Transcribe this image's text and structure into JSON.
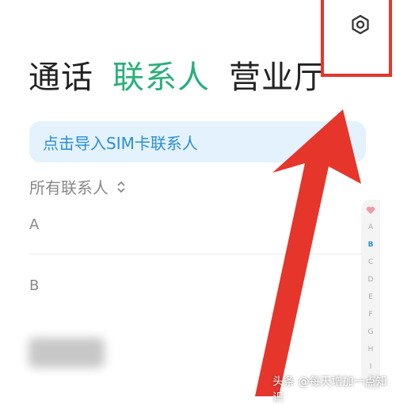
{
  "header": {
    "settings_icon": "gear-icon"
  },
  "tabs": [
    {
      "label": "通话",
      "active": false
    },
    {
      "label": "联系人",
      "active": true
    },
    {
      "label": "营业厅",
      "active": false
    }
  ],
  "import_banner": {
    "label": "点击导入SIM卡联系人"
  },
  "filter": {
    "label": "所有联系人",
    "icon": "sort-toggle-icon"
  },
  "sections": [
    {
      "letter": "A"
    },
    {
      "letter": "B"
    }
  ],
  "alphabet_index": {
    "favorite_icon": "heart-icon",
    "letters": [
      "A",
      "B",
      "C",
      "D",
      "E",
      "F",
      "G",
      "H",
      "I"
    ],
    "current": "B"
  },
  "watermark": "头条 @每天增加一点知识",
  "colors": {
    "active_tab": "#29b07a",
    "banner_text": "#2a8fd4",
    "banner_bg": "#e3f2fc",
    "annotation_red": "#e6352b"
  }
}
